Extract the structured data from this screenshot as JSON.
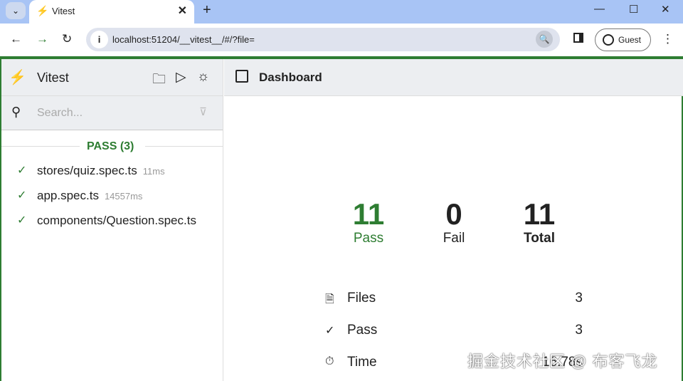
{
  "browser": {
    "tab_title": "Vitest",
    "url": "localhost:51204/__vitest__/#/?file=",
    "profile": "Guest"
  },
  "sidebar": {
    "title": "Vitest",
    "search_placeholder": "Search...",
    "group_label": "PASS (3)",
    "items": [
      {
        "name": "stores/quiz.spec.ts",
        "duration": "11ms"
      },
      {
        "name": "app.spec.ts",
        "duration": "14557ms"
      },
      {
        "name": "components/Question.spec.ts",
        "duration": ""
      }
    ]
  },
  "main": {
    "title": "Dashboard",
    "stats": [
      {
        "value": "11",
        "label": "Pass"
      },
      {
        "value": "0",
        "label": "Fail"
      },
      {
        "value": "11",
        "label": "Total"
      }
    ],
    "rows": [
      {
        "label": "Files",
        "value": "3"
      },
      {
        "label": "Pass",
        "value": "3"
      },
      {
        "label": "Time",
        "value": "16.78s"
      }
    ]
  },
  "watermark": "掘金技术社区 @ 布客飞龙",
  "colors": {
    "pass": "#2e7d32",
    "accent": "#e69b3a"
  }
}
